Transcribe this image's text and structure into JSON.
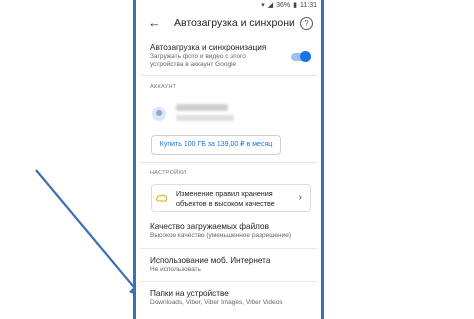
{
  "status": {
    "battery": "36%",
    "time": "11:31"
  },
  "appbar": {
    "title": "Автозагрузка и синхрони..."
  },
  "autoload": {
    "title": "Автозагрузка и синхронизация",
    "subtitle_line1": "Загружать фото и видео с этого",
    "subtitle_line2": "устройства в аккаунт Google",
    "enabled": true
  },
  "account": {
    "caption": "АККАУНТ",
    "buy_label": "Купить 100 ГБ за 139,00 ₽ в месяц"
  },
  "settings": {
    "caption": "НАСТРОЙКИ",
    "card_line1": "Изменение правил хранения",
    "card_line2": "объектов в высоком качестве"
  },
  "quality": {
    "title": "Качество загружаемых файлов",
    "value": "Высокое качество (уменьшенное разрешение)"
  },
  "mobile": {
    "title": "Использование моб. Интернета",
    "value": "Не использовать"
  },
  "folders": {
    "title": "Папки на устройстве",
    "value": "Downloads, Viber, Viber Images, Viber Videos"
  },
  "colors": {
    "accent": "#1a73e8",
    "frame": "#3b6fb6"
  }
}
